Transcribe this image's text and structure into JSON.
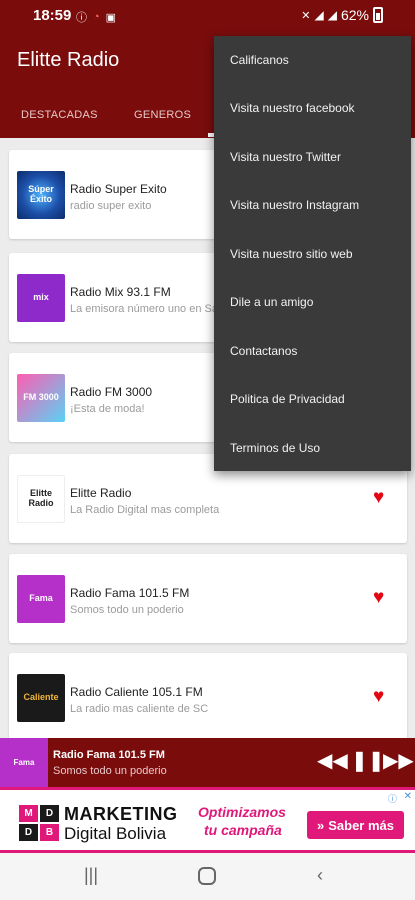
{
  "status_bar": {
    "time": "18:59",
    "battery": "62%",
    "icons_left": [
      "circle-i-icon",
      "wifi-icon",
      "image-icon"
    ],
    "icons_right": [
      "mute-icon",
      "signal-icon",
      "signal-bars-icon",
      "battery-icon"
    ]
  },
  "app": {
    "title": "Elitte Radio"
  },
  "tabs": [
    {
      "label": "DESTACADAS"
    },
    {
      "label": "GENEROS"
    }
  ],
  "stations": [
    {
      "name": "Radio Super Exito",
      "description": "radio super exito",
      "logo_text": "Súper Éxito",
      "favorite": false
    },
    {
      "name": "Radio Mix 93.1 FM",
      "description": "La emisora número uno en Sa",
      "logo_text": "mix",
      "favorite": false
    },
    {
      "name": "Radio FM 3000",
      "description": "¡Esta de moda!",
      "logo_text": "FM 3000",
      "favorite": false
    },
    {
      "name": "Elitte Radio",
      "description": "La Radio Digital mas completa",
      "logo_text": "Elitte Radio",
      "favorite": true
    },
    {
      "name": "Radio Fama 101.5 FM",
      "description": "Somos todo un poderio",
      "logo_text": "Fama",
      "favorite": true
    },
    {
      "name": "Radio Caliente 105.1 FM",
      "description": "La radio mas caliente de SC",
      "logo_text": "Caliente",
      "favorite": true
    }
  ],
  "menu": {
    "items": [
      "Calificanos",
      "Visita nuestro facebook",
      "Visita nuestro Twitter",
      "Visita nuestro Instagram",
      "Visita nuestro sitio web",
      "Dile a un amigo",
      "Contactanos",
      "Politica de Privacidad",
      "Terminos de Uso"
    ]
  },
  "player": {
    "name": "Radio Fama 101.5 FM",
    "description": "Somos todo un poderio",
    "thumb_text": "Fama"
  },
  "ad": {
    "logo_letters": [
      "M",
      "D",
      "D",
      "B"
    ],
    "brand_line1": "MARKETING",
    "brand_line2": "Digital Bolivia",
    "tagline1": "Optimizamos",
    "tagline2": "tu campaña",
    "cta": "Saber más",
    "accent_color": "#e0187a"
  },
  "colors": {
    "primary": "#7a0c0c",
    "heart": "#e30613",
    "menu_bg": "#3a3a3a"
  }
}
